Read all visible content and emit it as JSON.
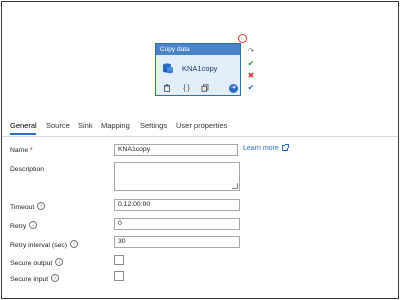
{
  "activity": {
    "header": "Copy data",
    "name": "KNA1copy",
    "icons": [
      "database-icon",
      "delete-icon",
      "code-braces-icon",
      "copy-icon",
      "go-arrow-icon"
    ]
  },
  "status_icons": [
    "error-circle-icon",
    "redo-icon",
    "success-check-icon",
    "failure-x-icon",
    "completion-check-icon"
  ],
  "colors": {
    "accent": "#2b6cc4",
    "header": "#4a83c8",
    "success": "#2e9a47",
    "failure": "#d83b3b"
  },
  "tabs": [
    {
      "label": "General",
      "active": true
    },
    {
      "label": "Source"
    },
    {
      "label": "Sink"
    },
    {
      "label": "Mapping"
    },
    {
      "label": "Settings"
    },
    {
      "label": "User properties"
    }
  ],
  "form": {
    "name_label": "Name",
    "name_required": "*",
    "name_value": "KNA1copy",
    "learn_more": "Learn more",
    "description_label": "Description",
    "description_value": "",
    "timeout_label": "Timeout",
    "timeout_value": "0.12:00:00",
    "retry_label": "Retry",
    "retry_value": "0",
    "retry_interval_label": "Retry interval (sec)",
    "retry_interval_value": "30",
    "secure_output_label": "Secure output",
    "secure_output_checked": false,
    "secure_input_label": "Secure input",
    "secure_input_checked": false
  }
}
